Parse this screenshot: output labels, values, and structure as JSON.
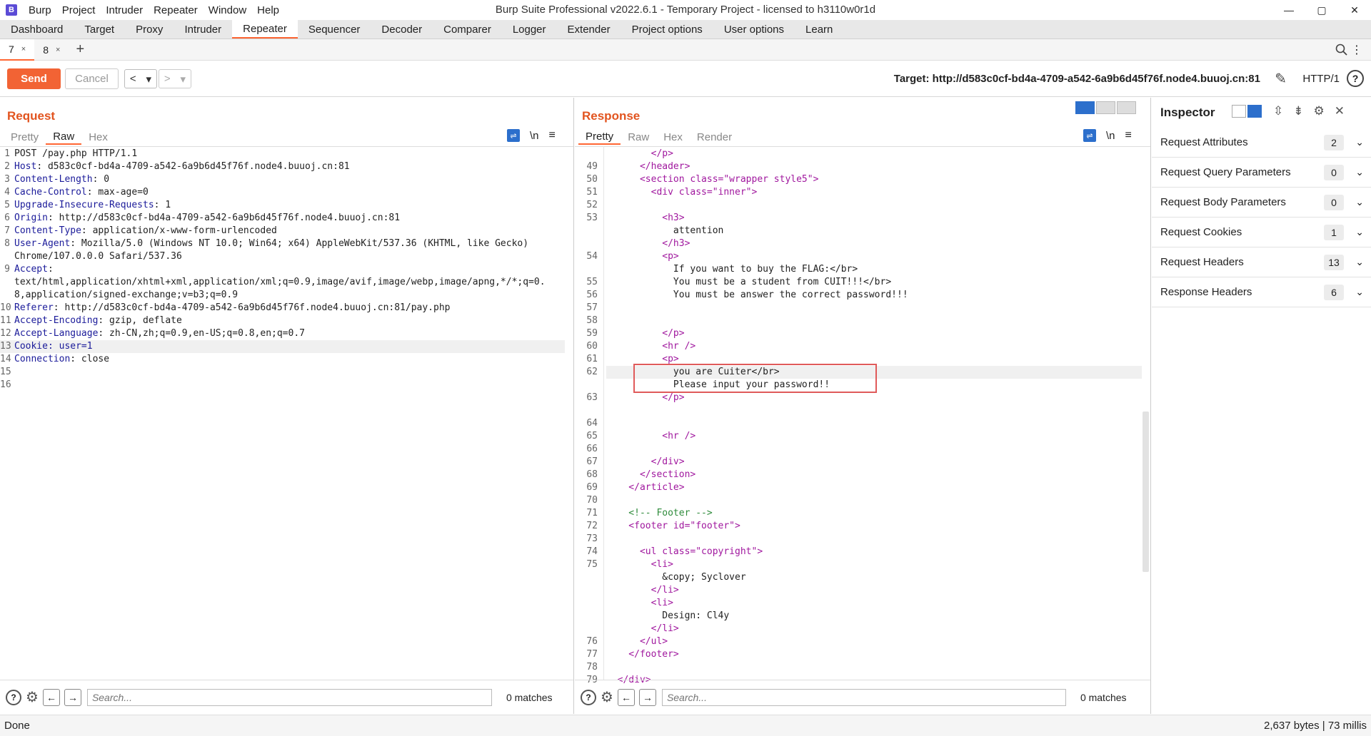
{
  "window": {
    "title": "Burp Suite Professional v2022.6.1 - Temporary Project - licensed to h3110w0r1d",
    "logo": "B",
    "menu": [
      "Burp",
      "Project",
      "Intruder",
      "Repeater",
      "Window",
      "Help"
    ],
    "controls": [
      "—",
      "▢",
      "✕"
    ]
  },
  "main_tabs": [
    "Dashboard",
    "Target",
    "Proxy",
    "Intruder",
    "Repeater",
    "Sequencer",
    "Decoder",
    "Comparer",
    "Logger",
    "Extender",
    "Project options",
    "User options",
    "Learn"
  ],
  "active_main_tab": "Repeater",
  "repeater_tabs": [
    {
      "label": "7",
      "close": "×",
      "active": true
    },
    {
      "label": "8",
      "close": "×",
      "active": false
    }
  ],
  "add_tab_label": "+",
  "toolbar": {
    "send_label": "Send",
    "cancel_label": "Cancel",
    "back_label": "<",
    "forward_label": ">",
    "dropdown_label": "▾",
    "target_label": "Target: http://d583c0cf-bd4a-4709-a542-6a9b6d45f76f.node4.buuoj.cn:81",
    "http_version": "HTTP/1",
    "help_label": "?"
  },
  "request": {
    "title": "Request",
    "tabs": [
      "Pretty",
      "Raw",
      "Hex"
    ],
    "active_tab": "Raw",
    "nl_label": "\\n",
    "menu_label": "≡",
    "lines": [
      {
        "n": "1",
        "header": "",
        "value": "POST /pay.php HTTP/1.1"
      },
      {
        "n": "2",
        "header": "Host",
        "value": ": d583c0cf-bd4a-4709-a542-6a9b6d45f76f.node4.buuoj.cn:81"
      },
      {
        "n": "3",
        "header": "Content-Length",
        "value": ": 0"
      },
      {
        "n": "4",
        "header": "Cache-Control",
        "value": ": max-age=0"
      },
      {
        "n": "5",
        "header": "Upgrade-Insecure-Requests",
        "value": ": 1"
      },
      {
        "n": "6",
        "header": "Origin",
        "value": ": http://d583c0cf-bd4a-4709-a542-6a9b6d45f76f.node4.buuoj.cn:81"
      },
      {
        "n": "7",
        "header": "Content-Type",
        "value": ": application/x-www-form-urlencoded"
      },
      {
        "n": "8",
        "header": "User-Agent",
        "value": ": Mozilla/5.0 (Windows NT 10.0; Win64; x64) AppleWebKit/537.36 (KHTML, like Gecko)"
      },
      {
        "n": "",
        "header": "",
        "value": "Chrome/107.0.0.0 Safari/537.36"
      },
      {
        "n": "9",
        "header": "Accept",
        "value": ":"
      },
      {
        "n": "",
        "header": "",
        "value": "text/html,application/xhtml+xml,application/xml;q=0.9,image/avif,image/webp,image/apng,*/*;q=0."
      },
      {
        "n": "",
        "header": "",
        "value": "8,application/signed-exchange;v=b3;q=0.9"
      },
      {
        "n": "10",
        "header": "Referer",
        "value": ": http://d583c0cf-bd4a-4709-a542-6a9b6d45f76f.node4.buuoj.cn:81/pay.php"
      },
      {
        "n": "11",
        "header": "Accept-Encoding",
        "value": ": gzip, deflate"
      },
      {
        "n": "12",
        "header": "Accept-Language",
        "value": ": zh-CN,zh;q=0.9,en-US;q=0.8,en;q=0.7"
      },
      {
        "n": "13",
        "header": "Cookie",
        "value": ": user=1",
        "highlight": true
      },
      {
        "n": "14",
        "header": "Connection",
        "value": ": close"
      },
      {
        "n": "15",
        "header": "",
        "value": ""
      },
      {
        "n": "16",
        "header": "",
        "value": ""
      }
    ],
    "search_placeholder": "Search...",
    "matches": "0 matches"
  },
  "response": {
    "title": "Response",
    "tabs": [
      "Pretty",
      "Raw",
      "Hex",
      "Render"
    ],
    "active_tab": "Pretty",
    "nl_label": "\\n",
    "menu_label": "≡",
    "lines": [
      {
        "n": "",
        "text": "        </p>"
      },
      {
        "n": "49",
        "text": "      </header>"
      },
      {
        "n": "50",
        "text": "      <section class=\"wrapper style5\">"
      },
      {
        "n": "51",
        "text": "        <div class=\"inner\">"
      },
      {
        "n": "52",
        "text": ""
      },
      {
        "n": "53",
        "text": "          <h3>"
      },
      {
        "n": "",
        "text": "            attention"
      },
      {
        "n": "",
        "text": "          </h3>"
      },
      {
        "n": "54",
        "text": "          <p>"
      },
      {
        "n": "",
        "text": "            If you want to buy the FLAG:</br>"
      },
      {
        "n": "55",
        "text": "            You must be a student from CUIT!!!</br>"
      },
      {
        "n": "56",
        "text": "            You must be answer the correct password!!!"
      },
      {
        "n": "57",
        "text": ""
      },
      {
        "n": "58",
        "text": ""
      },
      {
        "n": "59",
        "text": "          </p>"
      },
      {
        "n": "60",
        "text": "          <hr />"
      },
      {
        "n": "61",
        "text": "          <p>"
      },
      {
        "n": "62",
        "text": "            you are Cuiter</br>",
        "highlight": true
      },
      {
        "n": "",
        "text": "            Please input your password!!"
      },
      {
        "n": "63",
        "text": "          </p>"
      },
      {
        "n": "",
        "text": ""
      },
      {
        "n": "64",
        "text": ""
      },
      {
        "n": "65",
        "text": "          <hr />"
      },
      {
        "n": "66",
        "text": ""
      },
      {
        "n": "67",
        "text": "        </div>"
      },
      {
        "n": "68",
        "text": "      </section>"
      },
      {
        "n": "69",
        "text": "    </article>"
      },
      {
        "n": "70",
        "text": ""
      },
      {
        "n": "71",
        "text": "    <!-- Footer -->"
      },
      {
        "n": "72",
        "text": "    <footer id=\"footer\">"
      },
      {
        "n": "73",
        "text": ""
      },
      {
        "n": "74",
        "text": "      <ul class=\"copyright\">"
      },
      {
        "n": "75",
        "text": "        <li>"
      },
      {
        "n": "",
        "text": "          &copy; Syclover"
      },
      {
        "n": "",
        "text": "        </li>"
      },
      {
        "n": "",
        "text": "        <li>"
      },
      {
        "n": "",
        "text": "          Design: Cl4y"
      },
      {
        "n": "",
        "text": "        </li>"
      },
      {
        "n": "76",
        "text": "      </ul>"
      },
      {
        "n": "77",
        "text": "    </footer>"
      },
      {
        "n": "78",
        "text": ""
      },
      {
        "n": "79",
        "text": "  </div>"
      }
    ],
    "search_placeholder": "Search...",
    "matches": "0 matches"
  },
  "inspector": {
    "title": "Inspector",
    "rows": [
      {
        "label": "Request Attributes",
        "count": "2"
      },
      {
        "label": "Request Query Parameters",
        "count": "0"
      },
      {
        "label": "Request Body Parameters",
        "count": "0"
      },
      {
        "label": "Request Cookies",
        "count": "1"
      },
      {
        "label": "Request Headers",
        "count": "13"
      },
      {
        "label": "Response Headers",
        "count": "6"
      }
    ]
  },
  "status": {
    "left": "Done",
    "right": "2,637 bytes | 73 millis"
  },
  "colors": {
    "accent": "#f26334",
    "tab_underline": "#ff6633",
    "header_name": "#1b1b9a",
    "html_tag": "#a0179e",
    "comment": "#2e8b3b",
    "highlight_box": "#e05a5a"
  }
}
